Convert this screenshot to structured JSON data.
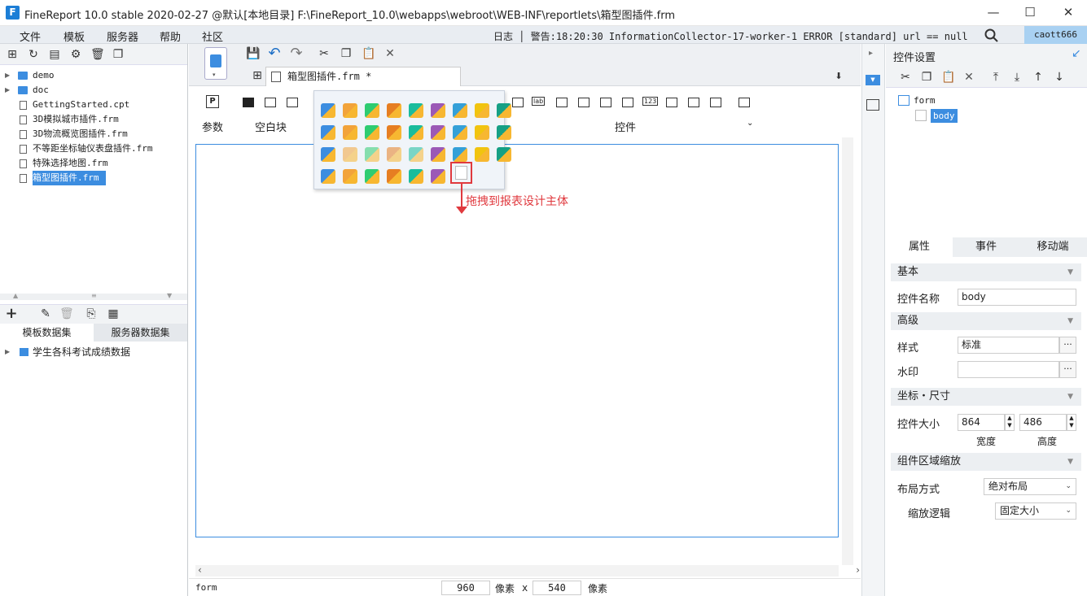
{
  "window": {
    "title": "FineReport 10.0 stable 2020-02-27 @默认[本地目录]    F:\\FineReport_10.0\\webapps\\webroot\\WEB-INF\\reportlets\\箱型图插件.frm",
    "min": "—",
    "max": "☐",
    "close": "✕"
  },
  "menu": {
    "items": [
      "文件",
      "模板",
      "服务器",
      "帮助",
      "社区"
    ],
    "log": "日志 │ 警告:18:20:30 InformationCollector-17-worker-1 ERROR [standard] url == null",
    "user": "caott666"
  },
  "filetree": {
    "items": [
      {
        "label": "demo",
        "type": "folder"
      },
      {
        "label": "doc",
        "type": "folder"
      },
      {
        "label": "GettingStarted.cpt",
        "type": "file"
      },
      {
        "label": "3D模拟城市插件.frm",
        "type": "file"
      },
      {
        "label": "3D物流概览图插件.frm",
        "type": "file"
      },
      {
        "label": "不等距坐标轴仪表盘插件.frm",
        "type": "file"
      },
      {
        "label": "特殊选择地图.frm",
        "type": "file"
      },
      {
        "label": "箱型图插件.frm",
        "type": "file",
        "selected": true
      }
    ]
  },
  "dataset": {
    "tabs": [
      "模板数据集",
      "服务器数据集"
    ],
    "items": [
      "学生各科考试成绩数据"
    ]
  },
  "editor": {
    "tab_label": "箱型图插件.frm *",
    "groups": [
      "参数",
      "空白块",
      "控件"
    ],
    "status_name": "form",
    "width": "960",
    "height": "540",
    "unit": "像素",
    "times": "x"
  },
  "annotation": "拖拽到报表设计主体",
  "right": {
    "header": "控件设置",
    "tree_root": "form",
    "tree_child": "body",
    "tabs": [
      "属性",
      "事件",
      "移动端"
    ],
    "sections": {
      "basic": "基本",
      "advanced": "高级",
      "coords": "坐标・尺寸",
      "zoom": "组件区域缩放"
    },
    "fields": {
      "name_label": "控件名称",
      "name_value": "body",
      "style_label": "样式",
      "style_value": "标准",
      "watermark_label": "水印",
      "watermark_value": "",
      "size_label": "控件大小",
      "width_value": "864",
      "height_value": "486",
      "width_caption": "宽度",
      "height_caption": "高度",
      "layout_label": "布局方式",
      "layout_value": "绝对布局",
      "zoom_label": "缩放逻辑",
      "zoom_value": "固定大小"
    }
  },
  "colors": {
    "accent": "#3c8de0",
    "highlight": "#e0393e"
  }
}
